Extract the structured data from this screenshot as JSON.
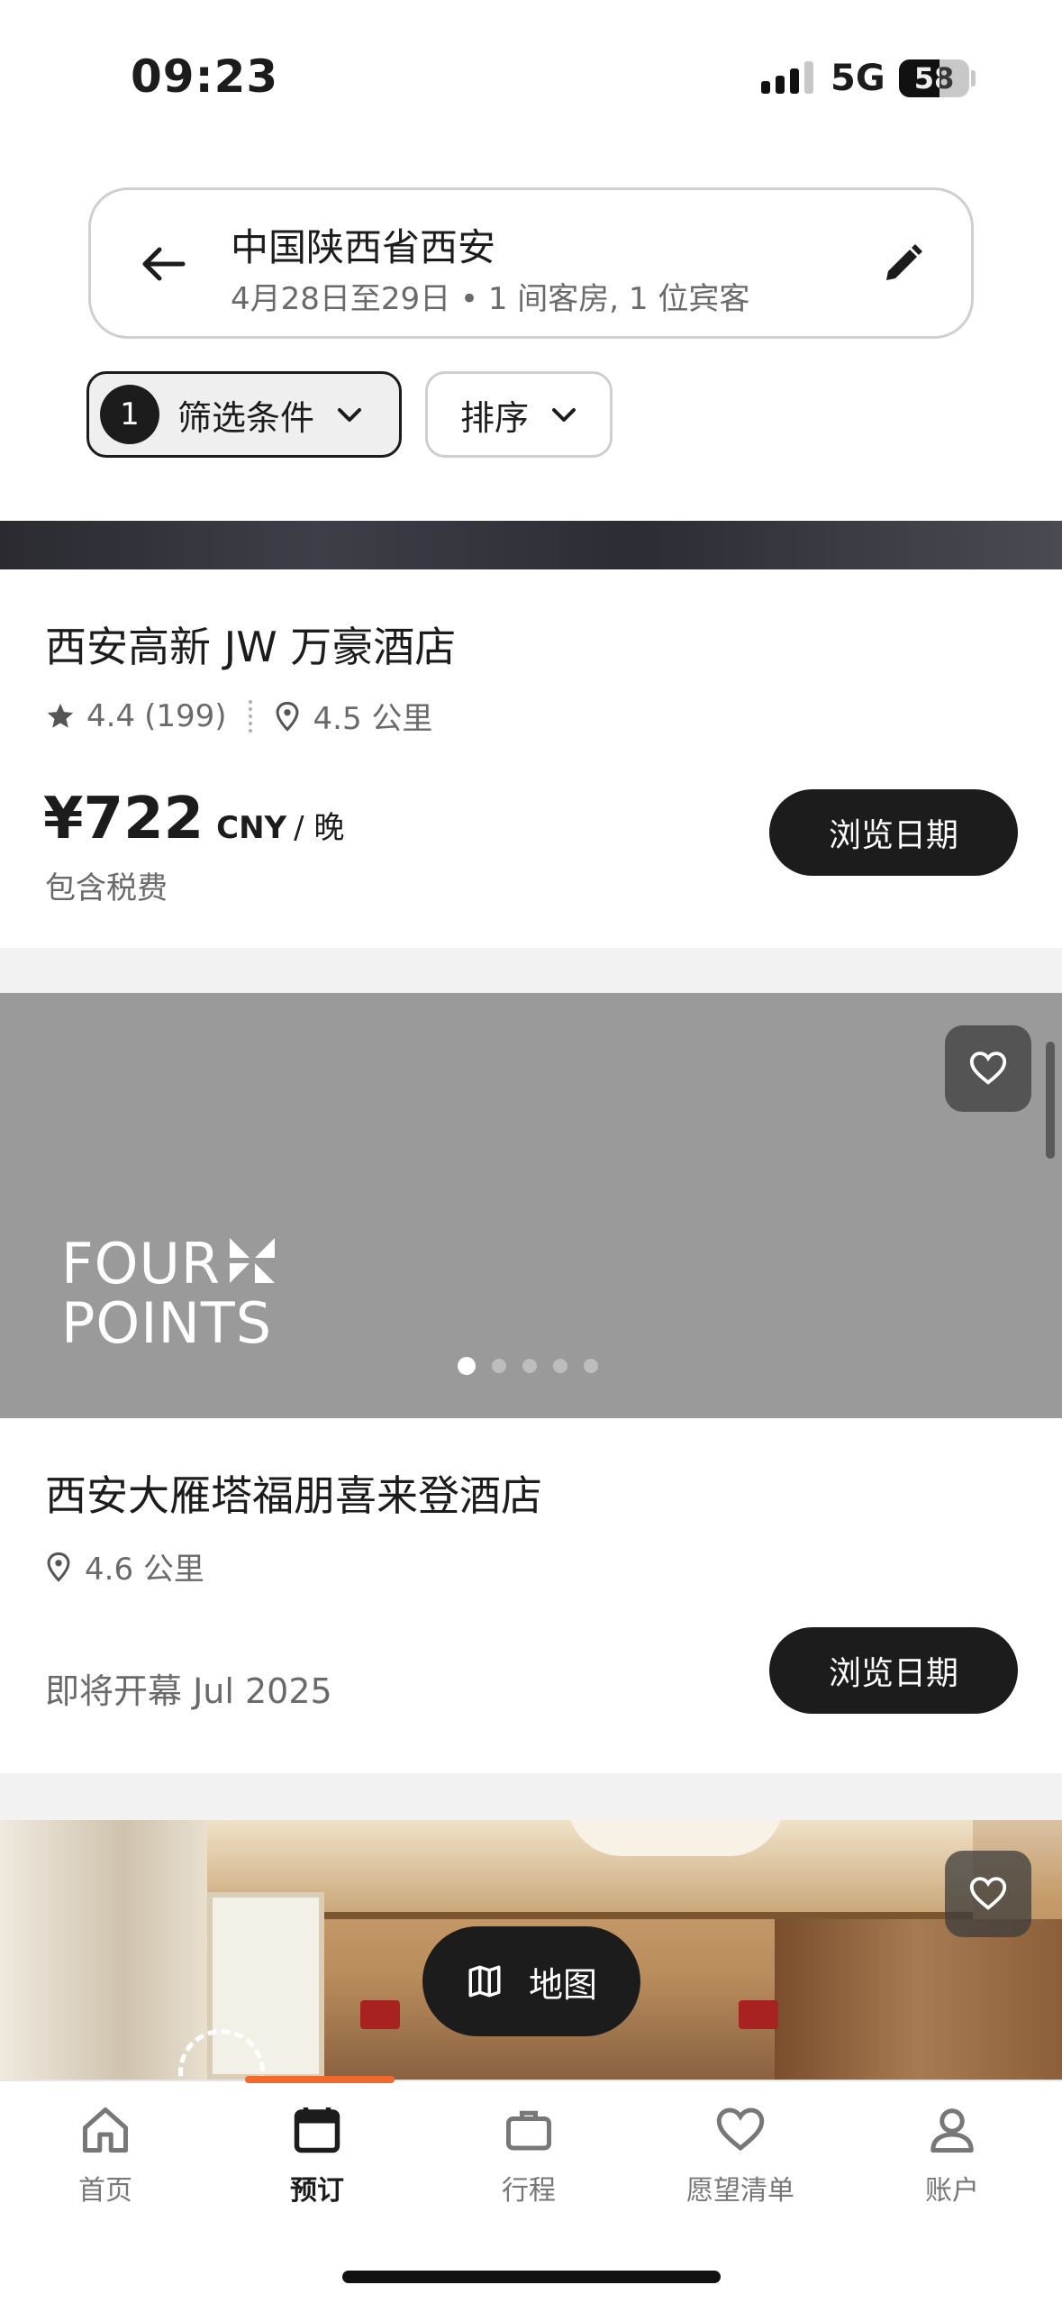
{
  "status_bar": {
    "time": "09:23",
    "network": "5G",
    "battery": "58",
    "battery_level": 0.58
  },
  "search": {
    "location": "中国陕西省西安",
    "details": "4月28日至29日 • 1 间客房, 1 位宾客"
  },
  "filters": {
    "filter_count": "1",
    "filter_label": "筛选条件",
    "sort_label": "排序"
  },
  "hotels": [
    {
      "name": "西安高新 JW 万豪酒店",
      "rating": "4.4",
      "reviews": "(199)",
      "distance": "4.5 公里",
      "price": "¥722",
      "currency": "CNY",
      "per_night": "/ 晚",
      "tax_note": "包含税费",
      "button": "浏览日期"
    },
    {
      "name": "西安大雁塔福朋喜来登酒店",
      "brand_logo": "FOUR POINTS",
      "distance": "4.6 公里",
      "opening": "即将开幕 Jul 2025",
      "button": "浏览日期"
    }
  ],
  "map_button": "地图",
  "tabs": [
    {
      "label": "首页",
      "icon": "home-icon"
    },
    {
      "label": "预订",
      "icon": "calendar-icon",
      "active": true
    },
    {
      "label": "行程",
      "icon": "briefcase-icon"
    },
    {
      "label": "愿望清单",
      "icon": "heart-icon"
    },
    {
      "label": "账户",
      "icon": "user-icon"
    }
  ]
}
